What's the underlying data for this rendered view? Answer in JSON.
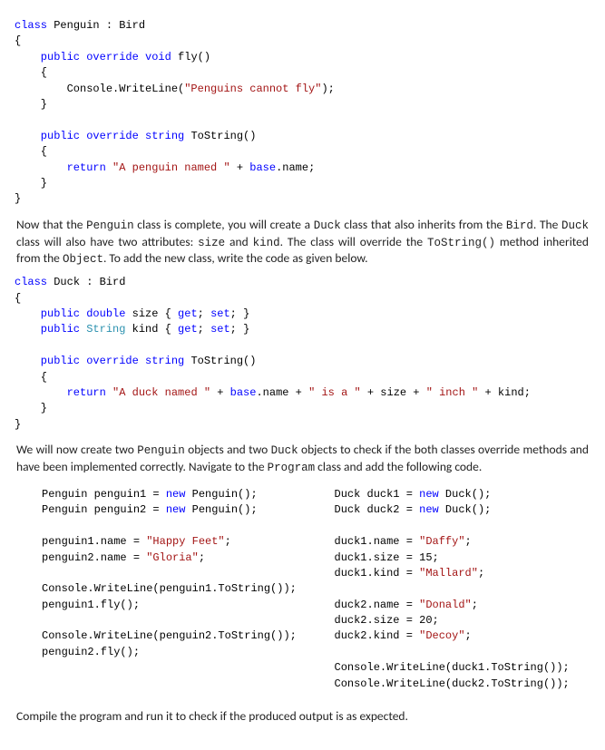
{
  "code1": {
    "l1": "class",
    "l1b": " Penguin : Bird",
    "l2": "{",
    "l3a": "    public",
    "l3b": " override",
    "l3c": " void",
    "l3d": " fly()",
    "l4": "    {",
    "l5a": "        Console.WriteLine(",
    "l5b": "\"Penguins cannot fly\"",
    "l5c": ");",
    "l6": "    }",
    "l7a": "    public",
    "l7b": " override",
    "l7c": " string",
    "l7d": " ToString()",
    "l8": "    {",
    "l9a": "        return",
    "l9b": " \"A penguin named \"",
    "l9c": " + ",
    "l9d": "base",
    "l9e": ".name;",
    "l10": "    }",
    "l11": "}"
  },
  "para1": {
    "t1": "Now that the ",
    "c1": "Penguin",
    "t2": " class is complete, you will create a ",
    "c2": "Duck",
    "t3": " class that also inherits from the ",
    "c3": "Bird",
    "t4": ". The ",
    "c4": "Duck",
    "t5": " class will also have two attributes: ",
    "c5": "size",
    "t6": " and ",
    "c6": "kind",
    "t7": ". The class will override the ",
    "c7": "ToString()",
    "t8": " method inherited from the ",
    "c8": "Object",
    "t9": ". To add the new class, write the code as given below."
  },
  "code2": {
    "l1a": "class",
    "l1b": " Duck : Bird",
    "l2": "{",
    "l3a": "    public",
    "l3b": " double",
    "l3c": " size { ",
    "l3d": "get",
    "l3e": "; ",
    "l3f": "set",
    "l3g": "; }",
    "l4a": "    public",
    "l4b": " String",
    "l4c": " kind { ",
    "l4d": "get",
    "l4e": "; ",
    "l4f": "set",
    "l4g": "; }",
    "l5a": "    public",
    "l5b": " override",
    "l5c": " string",
    "l5d": " ToString()",
    "l6": "    {",
    "l7a": "        return",
    "l7b": " \"A duck named \"",
    "l7c": " + ",
    "l7d": "base",
    "l7e": ".name + ",
    "l7f": "\" is a \"",
    "l7g": " + size + ",
    "l7h": "\" inch \"",
    "l7i": " + kind;",
    "l8": "    }",
    "l9": "}"
  },
  "para2": {
    "t1": "We will now create two ",
    "c1": "Penguin",
    "t2": " objects and two ",
    "c2": "Duck",
    "t3": " objects to check if the both classes override methods and have been implemented correctly. Navigate to the ",
    "c3": "Program",
    "t4": " class and add the following code."
  },
  "codeL": {
    "l1a": "Penguin penguin1 = ",
    "l1b": "new",
    "l1c": " Penguin();",
    "l2a": "Penguin penguin2 = ",
    "l2b": "new",
    "l2c": " Penguin();",
    "l3a": "penguin1.name = ",
    "l3b": "\"Happy Feet\"",
    "l3c": ";",
    "l4a": "penguin2.name = ",
    "l4b": "\"Gloria\"",
    "l4c": ";",
    "l5": "Console.WriteLine(penguin1.ToString());",
    "l6": "penguin1.fly();",
    "l7": "Console.WriteLine(penguin2.ToString());",
    "l8": "penguin2.fly();"
  },
  "codeR": {
    "l1a": "Duck duck1 = ",
    "l1b": "new",
    "l1c": " Duck();",
    "l2a": "Duck duck2 = ",
    "l2b": "new",
    "l2c": " Duck();",
    "l3a": "duck1.name = ",
    "l3b": "\"Daffy\"",
    "l3c": ";",
    "l4": "duck1.size = 15;",
    "l5a": "duck1.kind = ",
    "l5b": "\"Mallard\"",
    "l5c": ";",
    "l6a": "duck2.name = ",
    "l6b": "\"Donald\"",
    "l6c": ";",
    "l7": "duck2.size = 20;",
    "l8a": "duck2.kind = ",
    "l8b": "\"Decoy\"",
    "l8c": ";",
    "l9": "Console.WriteLine(duck1.ToString());",
    "l10": "Console.WriteLine(duck2.ToString());"
  },
  "para3": "Compile the program and run it to check if the produced output is as expected."
}
